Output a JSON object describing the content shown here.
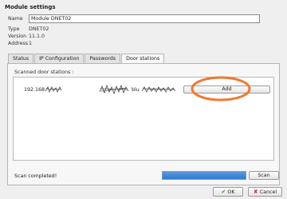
{
  "dialog": {
    "title": "Module settings",
    "name_label": "Name",
    "name_value": "Module DNET02",
    "type_label": "Type",
    "type_value": "DNET02",
    "version_label": "Version",
    "version_value": "11.1.0",
    "address_label": "Address",
    "address_value": "1"
  },
  "tabs": [
    {
      "label": "Status"
    },
    {
      "label": "IP Configuration"
    },
    {
      "label": "Passwords"
    },
    {
      "label": "Door stations",
      "active": true
    }
  ],
  "door_stations": {
    "scanned_label": "Scanned door stations :",
    "stations": [
      {
        "ip_prefix": "192.168",
        "name_prefix": "blu",
        "add_label": "Add"
      }
    ],
    "status_text": "Scan completed!",
    "progress_fraction": 1.0,
    "scan_label": "Scan"
  },
  "footer": {
    "ok_label": "OK",
    "cancel_label": "Cancel"
  },
  "colors": {
    "annotation": "#f07830",
    "progress": "#3a86d8",
    "ok_icon": "#3c8a2e",
    "cancel_icon": "#c2201c"
  },
  "icons": {
    "ok": "check-icon",
    "cancel": "close-icon",
    "redaction": "scribble"
  }
}
